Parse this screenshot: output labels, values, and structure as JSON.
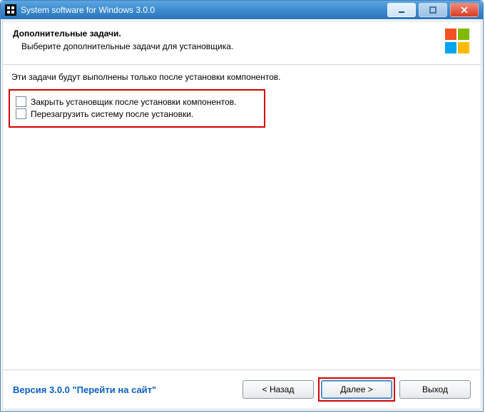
{
  "window": {
    "title": "System software for Windows 3.0.0"
  },
  "header": {
    "heading": "Дополнительные задачи.",
    "sub": "Выберите дополнительные задачи для установщика."
  },
  "body": {
    "info": "Эти задачи будут выполнены только после установки компонентов.",
    "checks": [
      {
        "label": "Закрыть установщик после установки компонентов.",
        "checked": false
      },
      {
        "label": "Перезагрузить систему после установки.",
        "checked": false
      }
    ]
  },
  "footer": {
    "version": "Версия 3.0.0   \"Перейти на сайт\"",
    "back": "< Назад",
    "next": "Далее >",
    "exit": "Выход"
  }
}
